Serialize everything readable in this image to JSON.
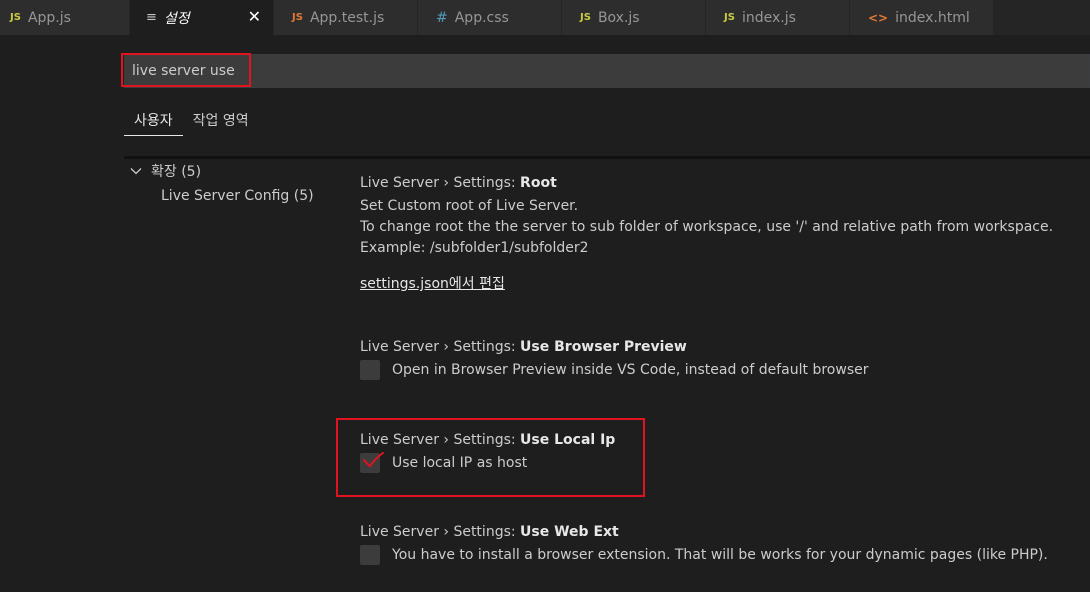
{
  "tabs": [
    {
      "icon": "JS",
      "icon_name": "js-file-icon",
      "label": "App.js",
      "active": false
    },
    {
      "icon": "≡",
      "icon_name": "settings-editor-icon",
      "label": "설정",
      "active": true
    },
    {
      "icon": "JS",
      "icon_name": "test-js-file-icon",
      "label": "App.test.js",
      "active": false
    },
    {
      "icon": "#",
      "icon_name": "css-file-icon",
      "label": "App.css",
      "active": false
    },
    {
      "icon": "JS",
      "icon_name": "js-file-icon",
      "label": "Box.js",
      "active": false
    },
    {
      "icon": "JS",
      "icon_name": "js-file-icon",
      "label": "index.js",
      "active": false
    },
    {
      "icon": "<>",
      "icon_name": "html-file-icon",
      "label": "index.html",
      "active": false
    }
  ],
  "search": {
    "value": "live server use"
  },
  "scope_tabs": {
    "user": "사용자",
    "workspace": "작업 영역"
  },
  "toc": {
    "extensions": "확장 (5)",
    "live_server_config": "Live Server Config (5)"
  },
  "settings": [
    {
      "category": "Live Server › Settings: ",
      "name": "Root",
      "description": [
        "Set Custom root of Live Server.",
        "To change root the the server to sub folder of workspace, use '/' and relative path from workspace.",
        "Example: /subfolder1/subfolder2"
      ],
      "link": "settings.json에서 편집"
    },
    {
      "category": "Live Server › Settings: ",
      "name": "Use Browser Preview",
      "checkbox_label": "Open in Browser Preview inside VS Code, instead of default browser",
      "checked": false
    },
    {
      "category": "Live Server › Settings: ",
      "name": "Use Local Ip",
      "checkbox_label": "Use local IP as host",
      "checked": false
    },
    {
      "category": "Live Server › Settings: ",
      "name": "Use Web Ext",
      "checkbox_label": "You have to install a browser extension. That will be works for your dynamic pages (like PHP).",
      "checked": false
    }
  ],
  "colors": {
    "background": "#1e1e1e",
    "tab_inactive": "#2d2d2d",
    "annotation_red": "#e0141e"
  }
}
